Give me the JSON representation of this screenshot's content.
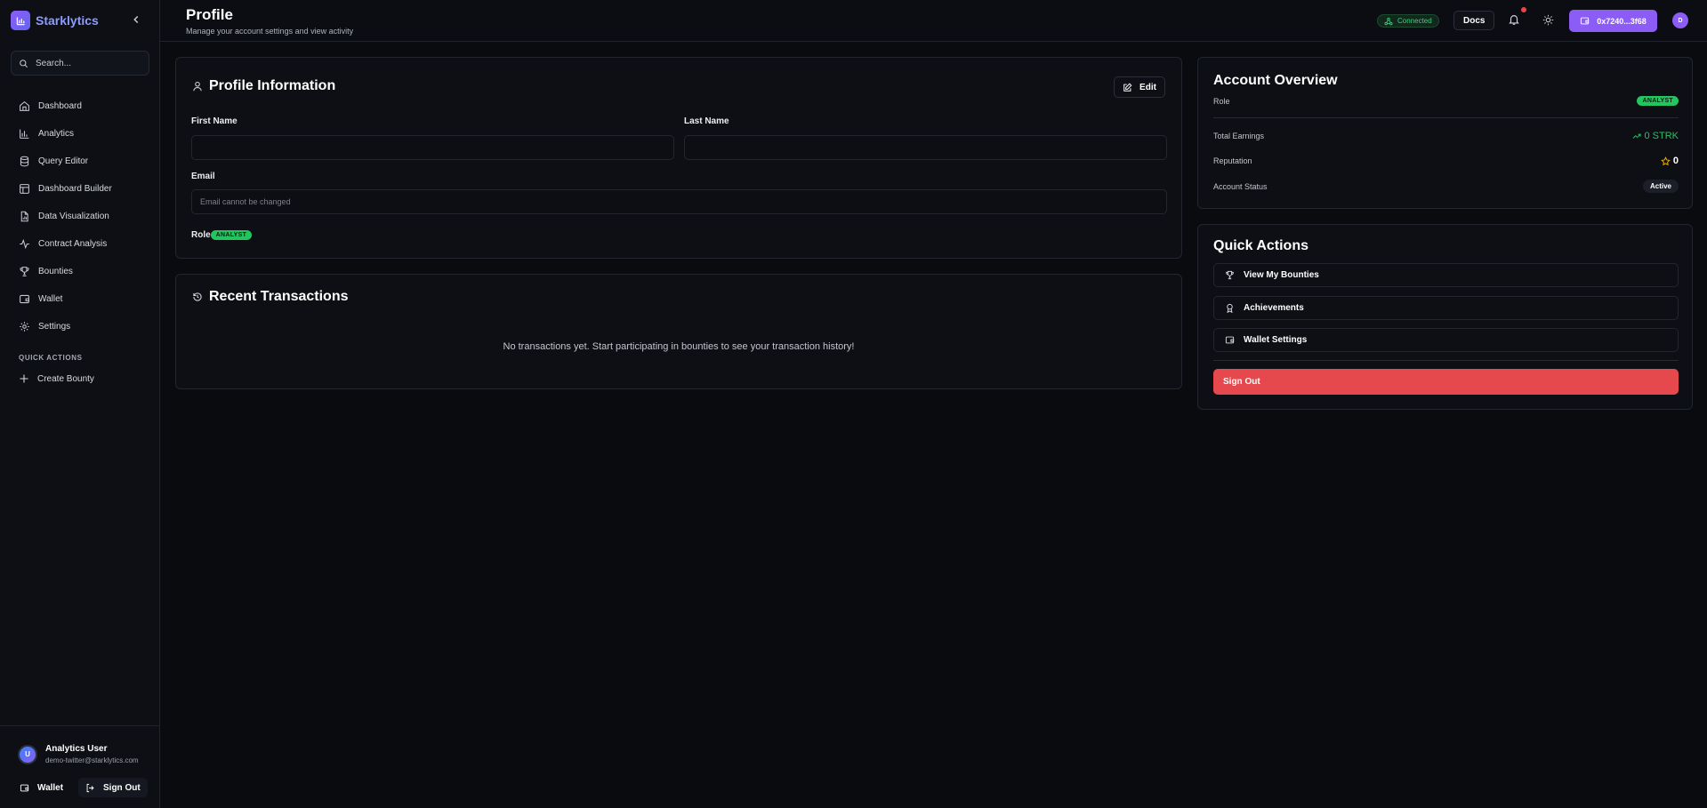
{
  "brand": {
    "name": "Starklytics"
  },
  "search": {
    "placeholder": "Search..."
  },
  "nav": {
    "items": [
      {
        "label": "Dashboard",
        "icon": "home-icon"
      },
      {
        "label": "Analytics",
        "icon": "bar-chart-icon"
      },
      {
        "label": "Query Editor",
        "icon": "database-icon"
      },
      {
        "label": "Dashboard Builder",
        "icon": "layout-icon"
      },
      {
        "label": "Data Visualization",
        "icon": "file-chart-icon"
      },
      {
        "label": "Contract Analysis",
        "icon": "activity-icon"
      },
      {
        "label": "Bounties",
        "icon": "trophy-icon"
      },
      {
        "label": "Wallet",
        "icon": "wallet-icon"
      },
      {
        "label": "Settings",
        "icon": "gear-icon"
      }
    ],
    "section_label": "QUICK ACTIONS",
    "create_label": "Create Bounty"
  },
  "user": {
    "initial": "U",
    "name": "Analytics User",
    "email": "demo-twitter@starklytics.com",
    "wallet_label": "Wallet",
    "signout_label": "Sign Out"
  },
  "header": {
    "title": "Profile",
    "subtitle": "Manage your account settings and view activity",
    "status": "Connected",
    "docs_label": "Docs",
    "wallet_address": "0x7240...3f68",
    "avatar_initial": "D"
  },
  "profile": {
    "title": "Profile Information",
    "edit_label": "Edit",
    "first_name_label": "First Name",
    "first_name_value": "",
    "last_name_label": "Last Name",
    "last_name_value": "",
    "email_label": "Email",
    "email_placeholder": "Email cannot be changed",
    "role_label": "Role",
    "role_value": "ANALYST"
  },
  "transactions": {
    "title": "Recent Transactions",
    "empty": "No transactions yet. Start participating in bounties to see your transaction history!"
  },
  "overview": {
    "title": "Account Overview",
    "role_label": "Role",
    "role_value": "ANALYST",
    "earnings_label": "Total Earnings",
    "earnings_value": "0 STRK",
    "reputation_label": "Reputation",
    "reputation_value": "0",
    "status_label": "Account Status",
    "status_value": "Active"
  },
  "quick_actions": {
    "title": "Quick Actions",
    "items": [
      {
        "label": "View My Bounties",
        "icon": "trophy-icon"
      },
      {
        "label": "Achievements",
        "icon": "award-icon"
      },
      {
        "label": "Wallet Settings",
        "icon": "wallet-icon"
      }
    ],
    "signout_label": "Sign Out"
  },
  "colors": {
    "accent": "#8b5cf6",
    "success": "#22c55e",
    "danger": "#e5484d",
    "background": "#0a0b0f"
  }
}
